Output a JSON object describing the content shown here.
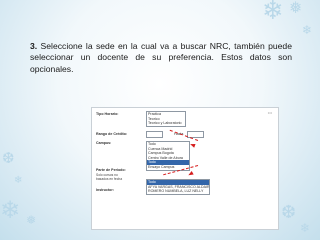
{
  "slide": {
    "step_number": "3.",
    "instruction": "Seleccione la sede en la cual va a buscar NRC, también puede seleccionar un docente de su preferencia. Estos datos son opcionales."
  },
  "form": {
    "tipo_horario_label": "Tipo Horario:",
    "tipo_horario_options": [
      "Practica",
      "Teorico",
      "Teorico y Laboratorio"
    ],
    "rango_credito_label": "Rango de Crédito:",
    "hasta_label": "Hasta",
    "campus_label": "Campus:",
    "campus_options": [
      "Todo",
      "Cuenca Madrid",
      "Campus Bogota",
      "Centro Valle de Abura",
      "Todo",
      "Ensayo Campus"
    ],
    "campus_selected_index": 4,
    "parte_periodo_label": "Parte de Periodo:",
    "parte_periodo_note": "Solo cursos no basados en fecha",
    "instructor_label": "Instructor:",
    "instructor_options": [
      "Todo",
      "AFYA VARGAS, FRANCISCO ALDAIR",
      "ROMERO NUMBELA, LUZ NELLY"
    ],
    "instructor_selected_index": 0
  },
  "icons": [
    "snowflake-icon"
  ]
}
